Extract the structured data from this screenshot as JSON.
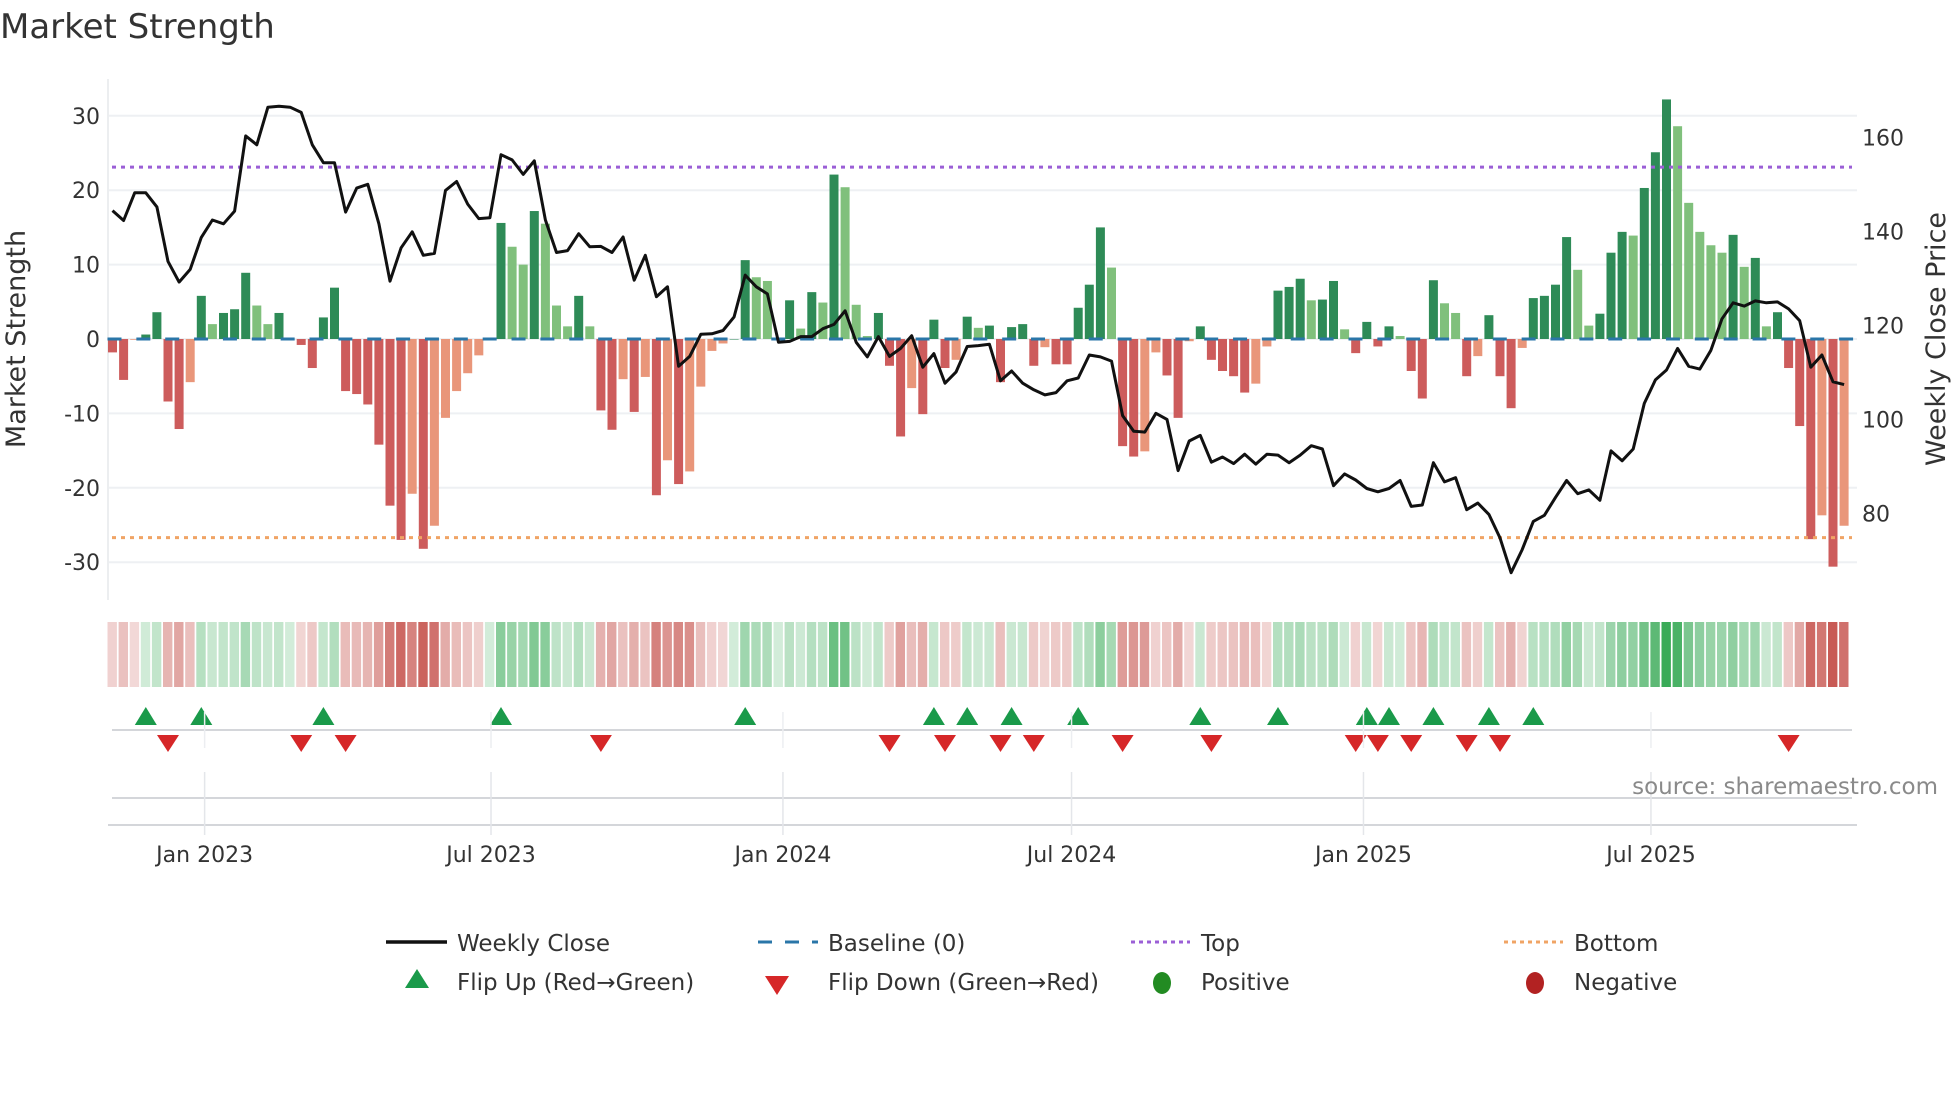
{
  "chart_data": {
    "type": "bar",
    "title": "Market Strength",
    "ylabel": "Market Strength",
    "y2label": "Weekly Close Price",
    "ylim": [
      -35,
      35
    ],
    "y2lim": [
      61.8,
      172.4
    ],
    "yticks": [
      30,
      20,
      10,
      0,
      -10,
      -20,
      -30
    ],
    "y2ticks": [
      160,
      140,
      120,
      100,
      80
    ],
    "xticks": [
      {
        "label": "Jan 2023",
        "week": 8.3
      },
      {
        "label": "Jul 2023",
        "week": 34.1
      },
      {
        "label": "Jan 2024",
        "week": 60.4
      },
      {
        "label": "Jul 2024",
        "week": 86.4
      },
      {
        "label": "Jan 2025",
        "week": 112.7
      },
      {
        "label": "Jul 2025",
        "week": 138.6
      }
    ],
    "top_level": 23.1,
    "bottom_level": -26.7,
    "baseline": 0,
    "strength": [
      -1.8,
      -5.5,
      -0.1,
      0.6,
      3.6,
      -8.4,
      -12.1,
      -5.8,
      5.8,
      2.0,
      3.5,
      4.0,
      8.9,
      4.5,
      2.0,
      3.5,
      0,
      -0.8,
      -3.9,
      2.9,
      6.9,
      -7.0,
      -7.4,
      -8.8,
      -14.2,
      -22.4,
      -27.0,
      -20.8,
      -28.2,
      -25.1,
      -10.6,
      -7.0,
      -4.6,
      -2.2,
      0,
      15.6,
      12.4,
      10.0,
      17.2,
      15.5,
      4.5,
      1.7,
      5.8,
      1.7,
      -9.6,
      -12.2,
      -5.4,
      -9.8,
      -5.1,
      -21.0,
      -16.3,
      -19.5,
      -17.8,
      -6.4,
      -1.6,
      -0.6,
      0,
      10.6,
      8.3,
      7.8,
      0,
      5.2,
      1.4,
      6.3,
      4.9,
      22.1,
      20.4,
      4.6,
      0.4,
      3.5,
      -3.6,
      -13.1,
      -6.6,
      -10.1,
      2.6,
      -3.9,
      -2.8,
      3.0,
      1.5,
      1.8,
      -5.8,
      1.6,
      2.0,
      -3.6,
      -1.1,
      -3.4,
      -3.4,
      4.2,
      7.3,
      15.0,
      9.6,
      -14.4,
      -15.8,
      -15.1,
      -1.8,
      -4.9,
      -10.6,
      -0.3,
      1.7,
      -2.8,
      -4.3,
      -5.0,
      -7.2,
      -6.0,
      -1.0,
      6.5,
      7.0,
      8.1,
      5.2,
      5.3,
      7.8,
      1.3,
      -1.9,
      2.3,
      -1.0,
      1.7,
      0.4,
      -4.3,
      -8.0,
      7.9,
      4.8,
      3.5,
      -5.0,
      -2.3,
      3.2,
      -5.0,
      -9.3,
      -1.2,
      5.5,
      5.8,
      7.3,
      13.7,
      9.3,
      1.8,
      3.4,
      11.6,
      14.4,
      13.9,
      20.3,
      25.1,
      32.2,
      28.6,
      18.3,
      14.4,
      12.6,
      11.6,
      14.0,
      9.7,
      10.9,
      1.7,
      3.6,
      -3.9,
      -11.7,
      -26.9,
      -23.7,
      -30.6,
      -25.1
    ],
    "weekly_close": [
      144.4,
      142.3,
      148.2,
      148.2,
      145.2,
      133.6,
      129.2,
      131.9,
      138.7,
      142.4,
      141.6,
      144.3,
      160.3,
      158.4,
      166.4,
      166.6,
      166.4,
      165.3,
      158.4,
      154.6,
      154.6,
      144.1,
      149.2,
      150.0,
      141.6,
      129.4,
      136.5,
      139.9,
      134.9,
      135.3,
      148.7,
      150.6,
      145.8,
      142.7,
      142.9,
      156.3,
      155.2,
      152.1,
      155.0,
      142.4,
      135.5,
      135.9,
      139.5,
      136.7,
      136.8,
      135.5,
      138.8,
      129.6,
      134.9,
      126.1,
      128.2,
      111.3,
      113.4,
      118.1,
      118.2,
      118.9,
      121.8,
      130.7,
      128.2,
      126.7,
      116.4,
      116.6,
      117.6,
      117.6,
      119.3,
      120.2,
      123.1,
      116.4,
      113.3,
      117.6,
      113.4,
      115.1,
      117.8,
      111.1,
      114.0,
      107.7,
      110.1,
      115.5,
      115.7,
      116.0,
      108.2,
      110.3,
      107.7,
      106.3,
      105.2,
      105.7,
      108.2,
      108.8,
      113.7,
      113.3,
      112.4,
      100.8,
      97.5,
      97.3,
      101.3,
      100.0,
      89.1,
      95.4,
      96.6,
      90.9,
      92.0,
      90.6,
      92.6,
      90.5,
      92.6,
      92.4,
      90.8,
      92.4,
      94.4,
      93.7,
      85.9,
      88.4,
      87.1,
      85.3,
      84.6,
      85.3,
      87.0,
      81.5,
      81.8,
      90.8,
      86.7,
      87.6,
      80.8,
      82.2,
      79.8,
      74.8,
      67.4,
      72.3,
      78.3,
      79.6,
      83.4,
      87.0,
      84.2,
      85.0,
      82.8,
      93.3,
      91.2,
      93.7,
      103.4,
      108.4,
      110.5,
      115.1,
      111.3,
      110.7,
      114.7,
      121.4,
      124.8,
      124.1,
      125.2,
      124.8,
      125.0,
      123.5,
      121.0,
      111.1,
      113.7,
      108.0,
      107.4
    ],
    "legend": {
      "weekly_close": "Weekly Close",
      "baseline": "Baseline (0)",
      "top": "Top",
      "bottom": "Bottom",
      "flip_up": "Flip Up (Red→Green)",
      "flip_down": "Flip Down (Green→Red)",
      "positive": "Positive",
      "negative": "Negative"
    },
    "legend_position": "bottom",
    "grid": true
  },
  "source": "source: sharemaestro.com",
  "colors": {
    "pos_strong": "#2e8b57",
    "pos_weak": "#80c07c",
    "neg_strong": "#cd5c5c",
    "neg_weak": "#e9967a",
    "top": "#9b5fd6",
    "bottom": "#f0a465",
    "baseline": "#2a76a8",
    "flip_up": "#1a9a4a",
    "flip_down": "#d62728",
    "positive": "#228b22",
    "negative": "#b22222",
    "price": "#111111"
  }
}
